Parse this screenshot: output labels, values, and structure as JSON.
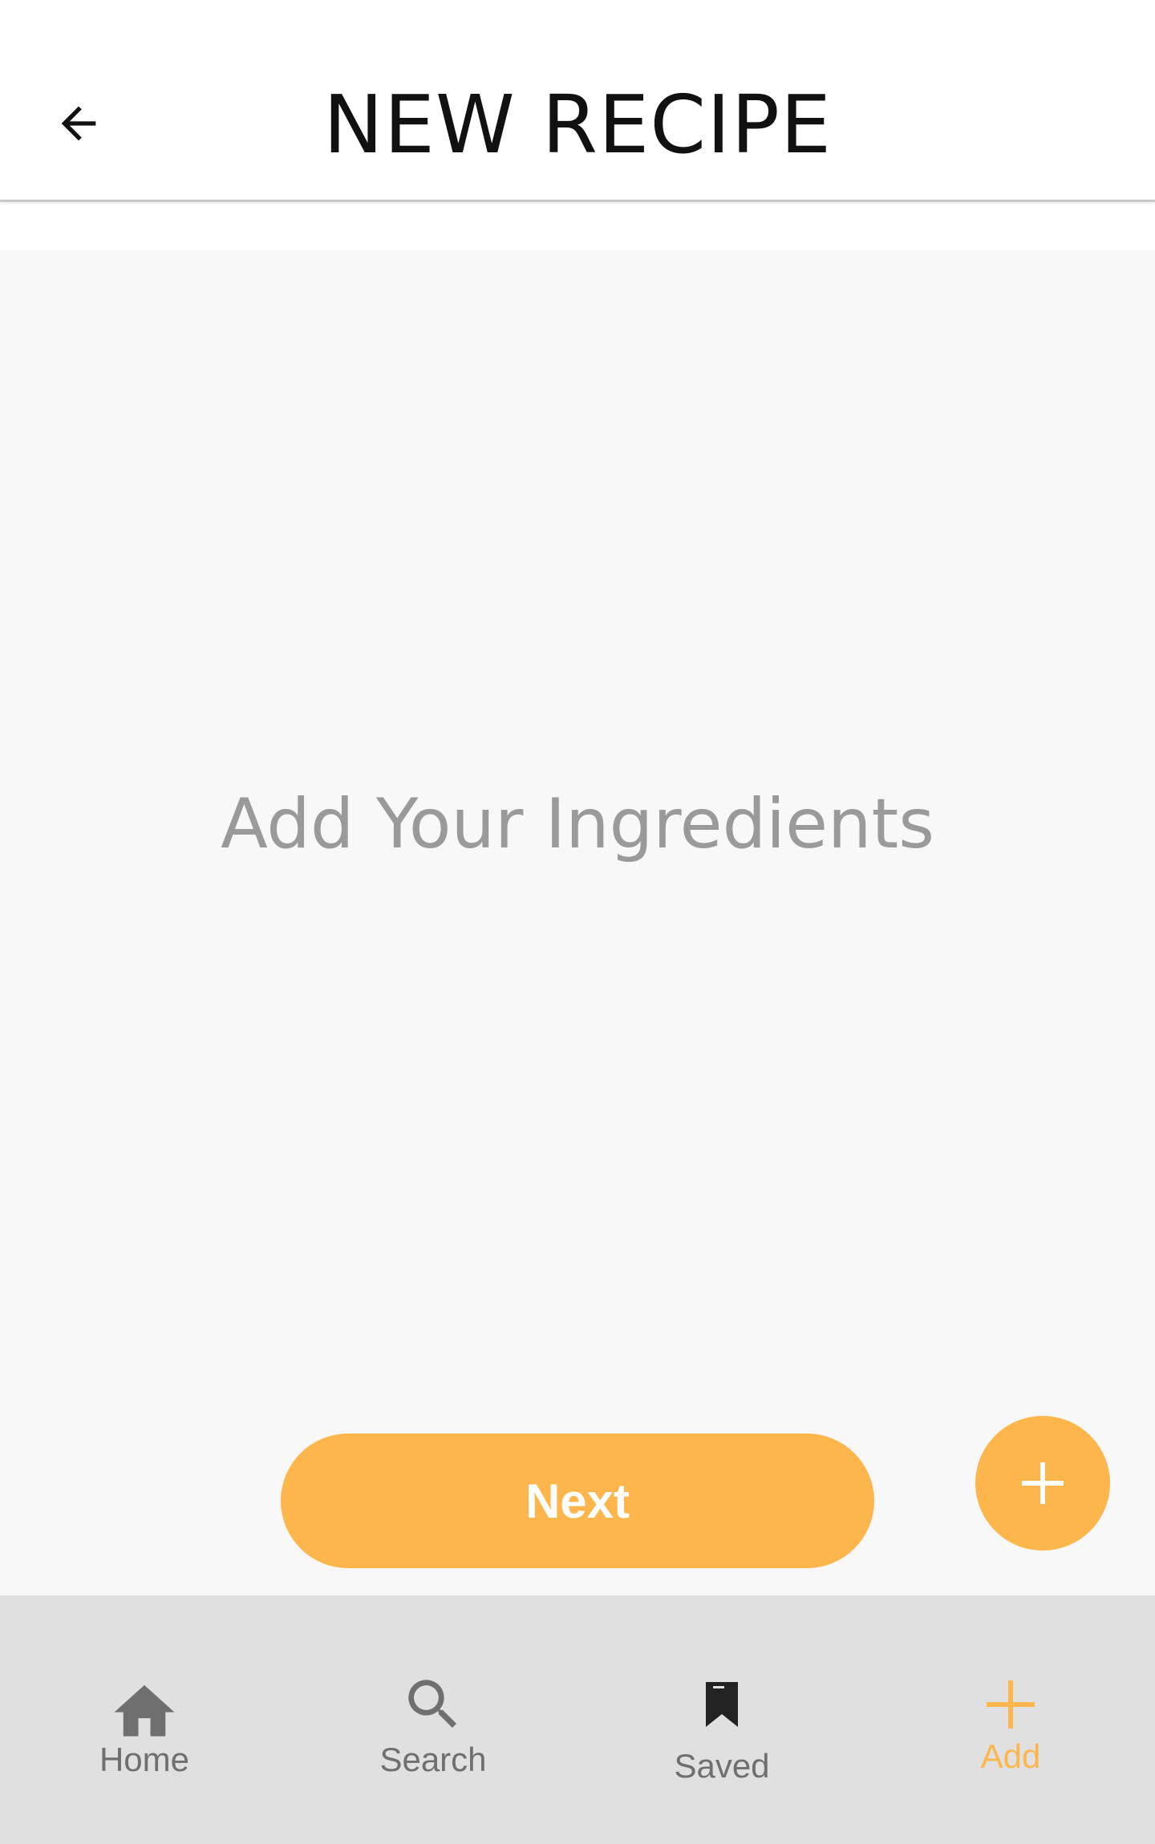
{
  "header": {
    "title": "NEW RECIPE",
    "back_icon": "arrow-left-icon"
  },
  "main": {
    "empty_message": "Add Your Ingredients",
    "next_label": "Next",
    "fab_icon": "plus-icon"
  },
  "bottom_nav": {
    "items": [
      {
        "label": "Home",
        "icon": "home-icon",
        "active": false
      },
      {
        "label": "Search",
        "icon": "search-icon",
        "active": false
      },
      {
        "label": "Saved",
        "icon": "bookmark-icon",
        "active": false
      },
      {
        "label": "Add",
        "icon": "plus-icon",
        "active": true
      }
    ]
  },
  "colors": {
    "accent": "#fcb64c",
    "nav_background": "#e0e0e0",
    "content_background": "#f8f8f8",
    "inactive_icon": "#6f6f6f",
    "placeholder_text": "#9a9a9a"
  }
}
